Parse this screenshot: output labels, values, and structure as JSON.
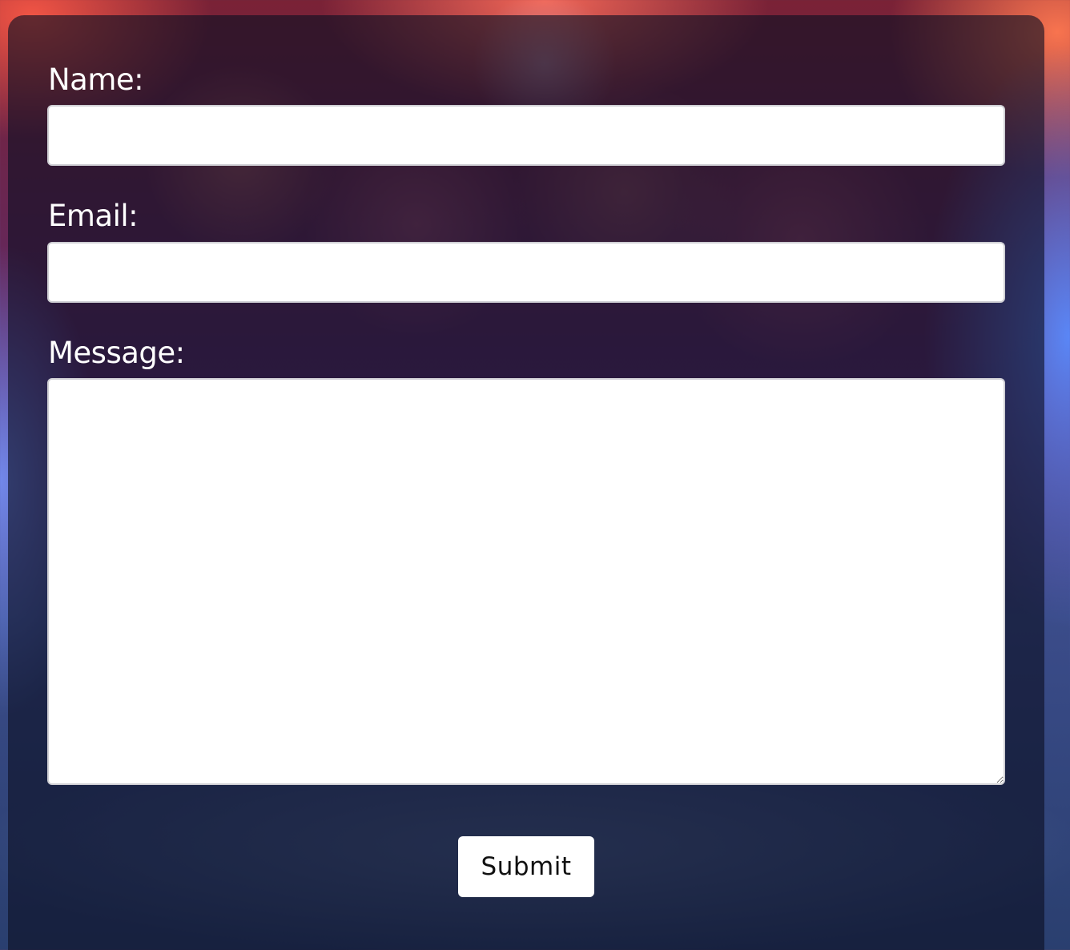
{
  "form": {
    "name_label": "Name:",
    "name_value": "",
    "email_label": "Email:",
    "email_value": "",
    "message_label": "Message:",
    "message_value": "",
    "submit_label": "Submit"
  }
}
